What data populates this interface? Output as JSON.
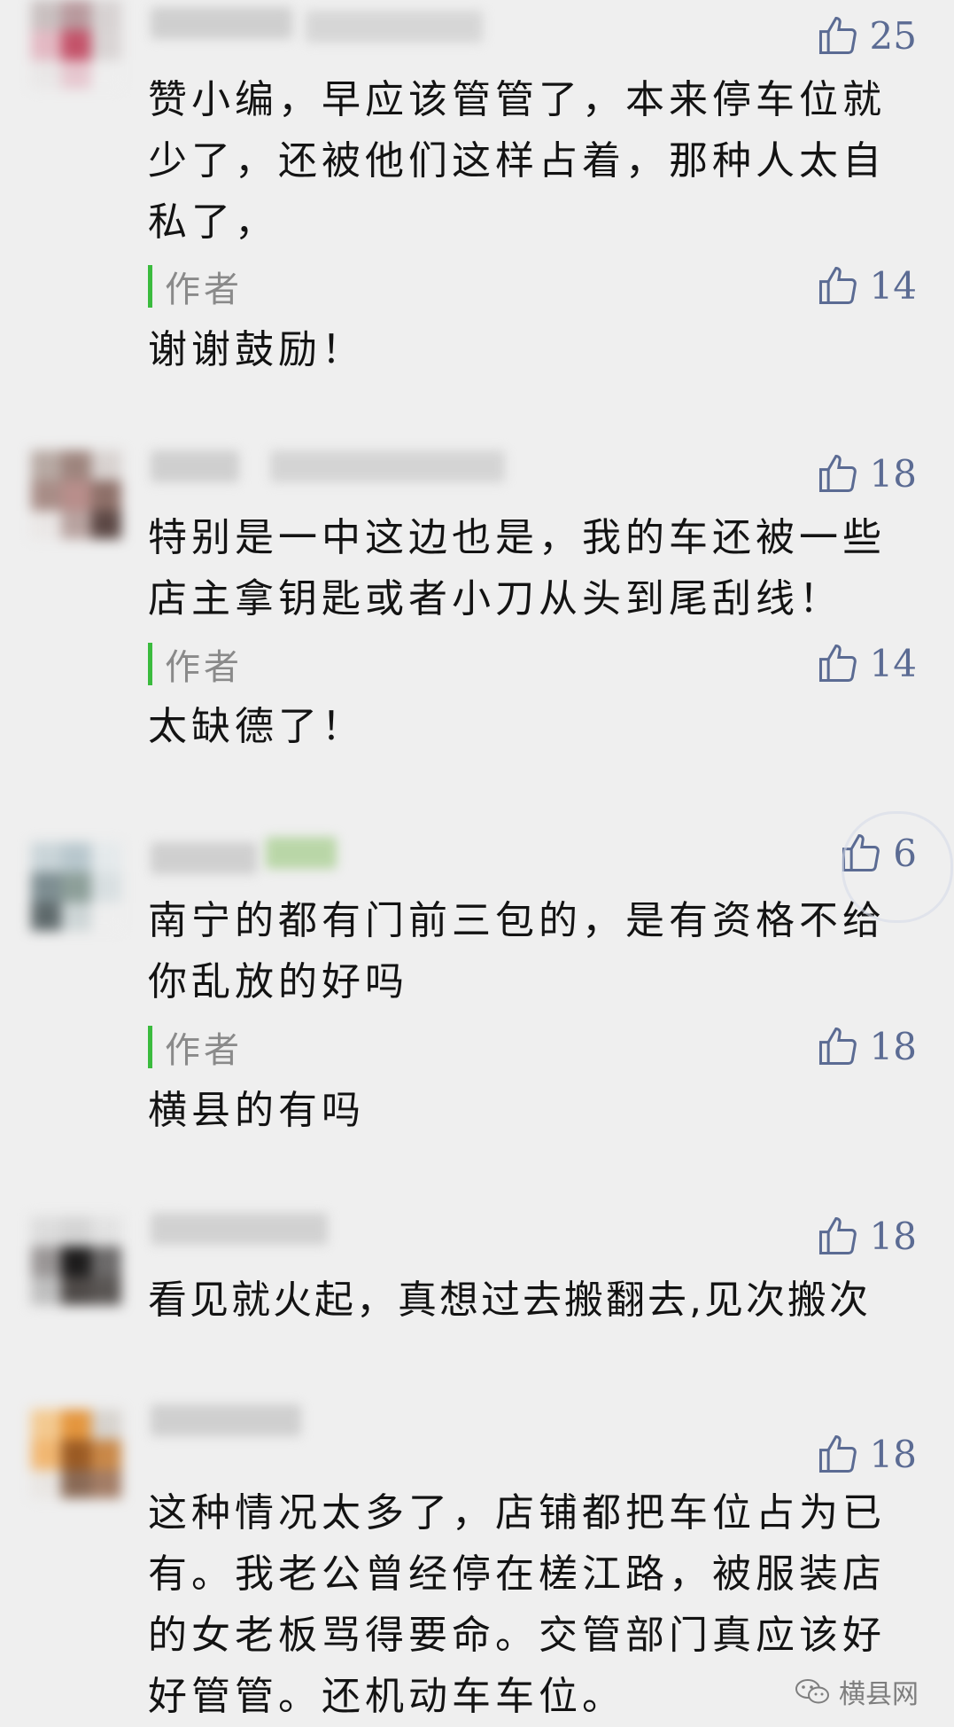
{
  "comments": [
    {
      "likes": "25",
      "text": "赞小编，早应该管管了，本来停车位就少了，还被他们这样占着，那种人太自私了，",
      "reply": {
        "label": "作者",
        "likes": "14",
        "text": "谢谢鼓励！"
      }
    },
    {
      "likes": "18",
      "text": "特别是一中这边也是，我的车还被一些店主拿钥匙或者小刀从头到尾刮线！",
      "reply": {
        "label": "作者",
        "likes": "14",
        "text": "太缺德了！"
      }
    },
    {
      "likes": "6",
      "text": "南宁的都有门前三包的，是有资格不给你乱放的好吗",
      "reply": {
        "label": "作者",
        "likes": "18",
        "text": "横县的有吗"
      }
    },
    {
      "likes": "18",
      "text": "看见就火起，真想过去搬翻去,见次搬次"
    },
    {
      "likes": "18",
      "text": "这种情况太多了，店铺都把车位占为已有。我老公曾经停在槎江路，被服装店的女老板骂得要命。交管部门真应该好好管管。还机动车车位。"
    }
  ],
  "footer": {
    "brand": "横县网"
  },
  "colors": {
    "background": "#efefef",
    "like": "#5b6b93",
    "author_bar": "#3bbb3e"
  }
}
